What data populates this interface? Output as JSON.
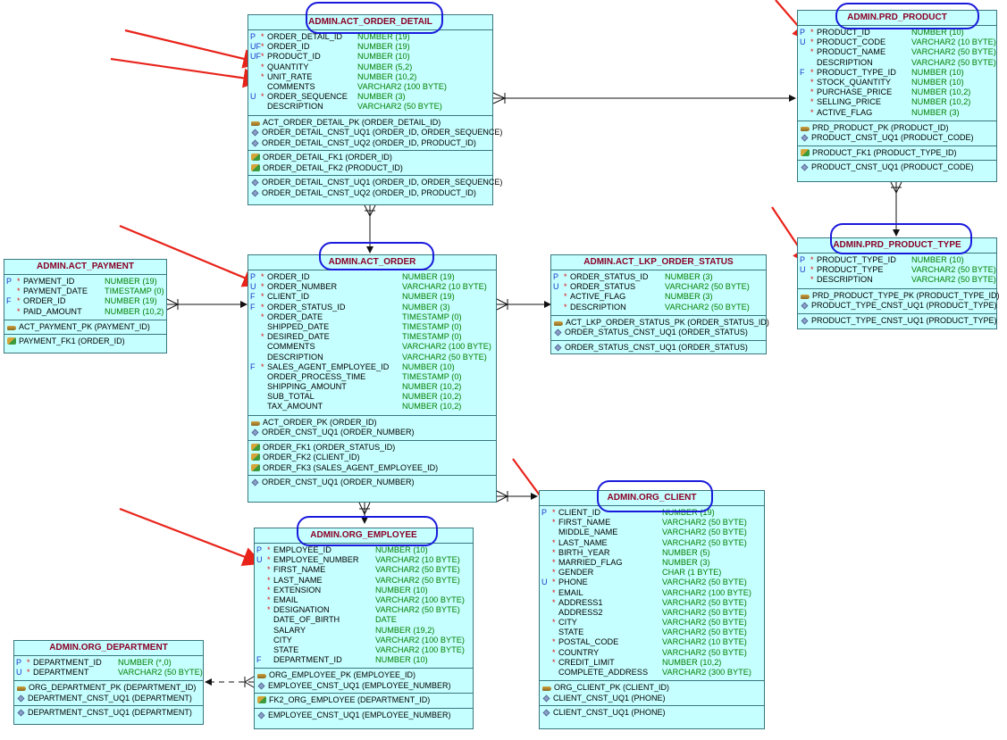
{
  "colors": {
    "table_fill": "#c6ffff",
    "border": "#37777f",
    "title": "#8a0026",
    "type": "#008000",
    "key": "#1a35c9",
    "mandatory": "#e01010",
    "highlight_oval": "#1a1adc",
    "arrow": "#e8231a"
  },
  "tables": {
    "act_order_detail": {
      "title": "ADMIN.ACT_ORDER_DETAIL",
      "columns": [
        {
          "key": "P",
          "mand": "*",
          "name": "ORDER_DETAIL_ID",
          "type": "NUMBER (19)"
        },
        {
          "key": "UF",
          "mand": "*",
          "name": "ORDER_ID",
          "type": "NUMBER (19)"
        },
        {
          "key": "UF",
          "mand": "*",
          "name": "PRODUCT_ID",
          "type": "NUMBER (10)"
        },
        {
          "key": "",
          "mand": "*",
          "name": "QUANTITY",
          "type": "NUMBER (5,2)"
        },
        {
          "key": "",
          "mand": "*",
          "name": "UNIT_RATE",
          "type": "NUMBER (10,2)"
        },
        {
          "key": "",
          "mand": "",
          "name": "COMMENTS",
          "type": "VARCHAR2 (100 BYTE)"
        },
        {
          "key": "U",
          "mand": "*",
          "name": "ORDER_SEQUENCE",
          "type": "NUMBER (3)"
        },
        {
          "key": "",
          "mand": "",
          "name": "DESCRIPTION",
          "type": "VARCHAR2 (50 BYTE)"
        }
      ],
      "sections": [
        [
          {
            "icon": "key",
            "text": "ACT_ORDER_DETAIL_PK (ORDER_DETAIL_ID)"
          },
          {
            "icon": "dia",
            "text": "ORDER_DETAIL_CNST_UQ1 (ORDER_ID, ORDER_SEQUENCE)"
          },
          {
            "icon": "dia",
            "text": "ORDER_DETAIL_CNST_UQ2 (ORDER_ID, PRODUCT_ID)"
          }
        ],
        [
          {
            "icon": "fk",
            "text": "ORDER_DETAIL_FK1 (ORDER_ID)"
          },
          {
            "icon": "fk",
            "text": "ORDER_DETAIL_FK2 (PRODUCT_ID)"
          }
        ],
        [
          {
            "icon": "dia",
            "text": "ORDER_DETAIL_CNST_UQ1 (ORDER_ID, ORDER_SEQUENCE)"
          },
          {
            "icon": "dia",
            "text": "ORDER_DETAIL_CNST_UQ2 (ORDER_ID, PRODUCT_ID)"
          }
        ]
      ]
    },
    "prd_product": {
      "title": "ADMIN.PRD_PRODUCT",
      "columns": [
        {
          "key": "P",
          "mand": "*",
          "name": "PRODUCT_ID",
          "type": "NUMBER (10)"
        },
        {
          "key": "U",
          "mand": "*",
          "name": "PRODUCT_CODE",
          "type": "VARCHAR2 (10 BYTE)"
        },
        {
          "key": "",
          "mand": "*",
          "name": "PRODUCT_NAME",
          "type": "VARCHAR2 (50 BYTE)"
        },
        {
          "key": "",
          "mand": "",
          "name": "DESCRIPTION",
          "type": "VARCHAR2 (50 BYTE)"
        },
        {
          "key": "F",
          "mand": "*",
          "name": "PRODUCT_TYPE_ID",
          "type": "NUMBER (10)"
        },
        {
          "key": "",
          "mand": "*",
          "name": "STOCK_QUANTITY",
          "type": "NUMBER (10)"
        },
        {
          "key": "",
          "mand": "*",
          "name": "PURCHASE_PRICE",
          "type": "NUMBER (10,2)"
        },
        {
          "key": "",
          "mand": "*",
          "name": "SELLING_PRICE",
          "type": "NUMBER (10,2)"
        },
        {
          "key": "",
          "mand": "*",
          "name": "ACTIVE_FLAG",
          "type": "NUMBER (3)"
        }
      ],
      "sections": [
        [
          {
            "icon": "key",
            "text": "PRD_PRODUCT_PK (PRODUCT_ID)"
          },
          {
            "icon": "dia",
            "text": "PRODUCT_CNST_UQ1 (PRODUCT_CODE)"
          }
        ],
        [
          {
            "icon": "fk",
            "text": "PRODUCT_FK1 (PRODUCT_TYPE_ID)"
          }
        ],
        [
          {
            "icon": "dia",
            "text": "PRODUCT_CNST_UQ1 (PRODUCT_CODE)"
          }
        ]
      ]
    },
    "prd_product_type": {
      "title": "ADMIN.PRD_PRODUCT_TYPE",
      "columns": [
        {
          "key": "P",
          "mand": "*",
          "name": "PRODUCT_TYPE_ID",
          "type": "NUMBER (10)"
        },
        {
          "key": "U",
          "mand": "*",
          "name": "PRODUCT_TYPE",
          "type": "VARCHAR2 (50 BYTE)"
        },
        {
          "key": "",
          "mand": "*",
          "name": "DESCRIPTION",
          "type": "VARCHAR2 (50 BYTE)"
        }
      ],
      "sections": [
        [
          {
            "icon": "key",
            "text": "PRD_PRODUCT_TYPE_PK (PRODUCT_TYPE_ID)"
          },
          {
            "icon": "dia",
            "text": "PRODUCT_TYPE_CNST_UQ1 (PRODUCT_TYPE)"
          }
        ],
        [
          {
            "icon": "dia",
            "text": "PRODUCT_TYPE_CNST_UQ1 (PRODUCT_TYPE)"
          }
        ]
      ]
    },
    "act_payment": {
      "title": "ADMIN.ACT_PAYMENT",
      "columns": [
        {
          "key": "P",
          "mand": "*",
          "name": "PAYMENT_ID",
          "type": "NUMBER (19)"
        },
        {
          "key": "",
          "mand": "*",
          "name": "PAYMENT_DATE",
          "type": "TIMESTAMP (0)"
        },
        {
          "key": "F",
          "mand": "*",
          "name": "ORDER_ID",
          "type": "NUMBER (19)"
        },
        {
          "key": "",
          "mand": "*",
          "name": "PAID_AMOUNT",
          "type": "NUMBER (10,2)"
        }
      ],
      "sections": [
        [
          {
            "icon": "key",
            "text": "ACT_PAYMENT_PK (PAYMENT_ID)"
          }
        ],
        [
          {
            "icon": "fk",
            "text": "PAYMENT_FK1 (ORDER_ID)"
          }
        ]
      ]
    },
    "act_order": {
      "title": "ADMIN.ACT_ORDER",
      "columns": [
        {
          "key": "P",
          "mand": "*",
          "name": "ORDER_ID",
          "type": "NUMBER (19)"
        },
        {
          "key": "U",
          "mand": "*",
          "name": "ORDER_NUMBER",
          "type": "VARCHAR2 (10 BYTE)"
        },
        {
          "key": "F",
          "mand": "*",
          "name": "CLIENT_ID",
          "type": "NUMBER (19)"
        },
        {
          "key": "F",
          "mand": "*",
          "name": "ORDER_STATUS_ID",
          "type": "NUMBER (3)"
        },
        {
          "key": "",
          "mand": "*",
          "name": "ORDER_DATE",
          "type": "TIMESTAMP (0)"
        },
        {
          "key": "",
          "mand": "",
          "name": "SHIPPED_DATE",
          "type": "TIMESTAMP (0)"
        },
        {
          "key": "",
          "mand": "*",
          "name": "DESIRED_DATE",
          "type": "TIMESTAMP (0)"
        },
        {
          "key": "",
          "mand": "",
          "name": "COMMENTS",
          "type": "VARCHAR2 (100 BYTE)"
        },
        {
          "key": "",
          "mand": "",
          "name": "DESCRIPTION",
          "type": "VARCHAR2 (50 BYTE)"
        },
        {
          "key": "F",
          "mand": "*",
          "name": "SALES_AGENT_EMPLOYEE_ID",
          "type": "NUMBER (10)"
        },
        {
          "key": "",
          "mand": "",
          "name": "ORDER_PROCESS_TIME",
          "type": "TIMESTAMP (0)"
        },
        {
          "key": "",
          "mand": "",
          "name": "SHIPPING_AMOUNT",
          "type": "NUMBER (10,2)"
        },
        {
          "key": "",
          "mand": "",
          "name": "SUB_TOTAL",
          "type": "NUMBER (10,2)"
        },
        {
          "key": "",
          "mand": "",
          "name": "TAX_AMOUNT",
          "type": "NUMBER (10,2)"
        }
      ],
      "sections": [
        [
          {
            "icon": "key",
            "text": "ACT_ORDER_PK (ORDER_ID)"
          },
          {
            "icon": "dia",
            "text": "ORDER_CNST_UQ1 (ORDER_NUMBER)"
          }
        ],
        [
          {
            "icon": "fk",
            "text": "ORDER_FK1 (ORDER_STATUS_ID)"
          },
          {
            "icon": "fk",
            "text": "ORDER_FK2 (CLIENT_ID)"
          },
          {
            "icon": "fk",
            "text": "ORDER_FK3 (SALES_AGENT_EMPLOYEE_ID)"
          }
        ],
        [
          {
            "icon": "dia",
            "text": "ORDER_CNST_UQ1 (ORDER_NUMBER)"
          }
        ]
      ]
    },
    "act_lkp_order_status": {
      "title": "ADMIN.ACT_LKP_ORDER_STATUS",
      "columns": [
        {
          "key": "P",
          "mand": "*",
          "name": "ORDER_STATUS_ID",
          "type": "NUMBER (3)"
        },
        {
          "key": "U",
          "mand": "*",
          "name": "ORDER_STATUS",
          "type": "VARCHAR2 (50 BYTE)"
        },
        {
          "key": "",
          "mand": "*",
          "name": "ACTIVE_FLAG",
          "type": "NUMBER (3)"
        },
        {
          "key": "",
          "mand": "*",
          "name": "DESCRIPTION",
          "type": "VARCHAR2 (50 BYTE)"
        }
      ],
      "sections": [
        [
          {
            "icon": "key",
            "text": "ACT_LKP_ORDER_STATUS_PK (ORDER_STATUS_ID)"
          },
          {
            "icon": "dia",
            "text": "ORDER_STATUS_CNST_UQ1 (ORDER_STATUS)"
          }
        ],
        [
          {
            "icon": "dia",
            "text": "ORDER_STATUS_CNST_UQ1 (ORDER_STATUS)"
          }
        ]
      ]
    },
    "org_employee": {
      "title": "ADMIN.ORG_EMPLOYEE",
      "columns": [
        {
          "key": "P",
          "mand": "*",
          "name": "EMPLOYEE_ID",
          "type": "NUMBER (10)"
        },
        {
          "key": "U",
          "mand": "*",
          "name": "EMPLOYEE_NUMBER",
          "type": "VARCHAR2 (10 BYTE)"
        },
        {
          "key": "",
          "mand": "*",
          "name": "FIRST_NAME",
          "type": "VARCHAR2 (50 BYTE)"
        },
        {
          "key": "",
          "mand": "*",
          "name": "LAST_NAME",
          "type": "VARCHAR2 (50 BYTE)"
        },
        {
          "key": "",
          "mand": "*",
          "name": "EXTENSION",
          "type": "NUMBER (10)"
        },
        {
          "key": "",
          "mand": "*",
          "name": "EMAIL",
          "type": "VARCHAR2 (100 BYTE)"
        },
        {
          "key": "",
          "mand": "*",
          "name": "DESIGNATION",
          "type": "VARCHAR2 (50 BYTE)"
        },
        {
          "key": "",
          "mand": "",
          "name": "DATE_OF_BIRTH",
          "type": "DATE"
        },
        {
          "key": "",
          "mand": "",
          "name": "SALARY",
          "type": "NUMBER (19,2)"
        },
        {
          "key": "",
          "mand": "",
          "name": "CITY",
          "type": "VARCHAR2 (100 BYTE)"
        },
        {
          "key": "",
          "mand": "",
          "name": "STATE",
          "type": "VARCHAR2 (100 BYTE)"
        },
        {
          "key": "F",
          "mand": "",
          "name": "DEPARTMENT_ID",
          "type": "NUMBER (10)"
        }
      ],
      "sections": [
        [
          {
            "icon": "key",
            "text": "ORG_EMPLOYEE_PK (EMPLOYEE_ID)"
          },
          {
            "icon": "dia",
            "text": "EMPLOYEE_CNST_UQ1 (EMPLOYEE_NUMBER)"
          }
        ],
        [
          {
            "icon": "fk",
            "text": "FK2_ORG_EMPLOYEE (DEPARTMENT_ID)"
          }
        ],
        [
          {
            "icon": "dia",
            "text": "EMPLOYEE_CNST_UQ1 (EMPLOYEE_NUMBER)"
          }
        ]
      ]
    },
    "org_client": {
      "title": "ADMIN.ORG_CLIENT",
      "columns": [
        {
          "key": "P",
          "mand": "*",
          "name": "CLIENT_ID",
          "type": "NUMBER (19)"
        },
        {
          "key": "",
          "mand": "*",
          "name": "FIRST_NAME",
          "type": "VARCHAR2 (50 BYTE)"
        },
        {
          "key": "",
          "mand": "",
          "name": "MIDDLE_NAME",
          "type": "VARCHAR2 (50 BYTE)"
        },
        {
          "key": "",
          "mand": "*",
          "name": "LAST_NAME",
          "type": "VARCHAR2 (50 BYTE)"
        },
        {
          "key": "",
          "mand": "*",
          "name": "BIRTH_YEAR",
          "type": "NUMBER (5)"
        },
        {
          "key": "",
          "mand": "*",
          "name": "MARRIED_FLAG",
          "type": "NUMBER (3)"
        },
        {
          "key": "",
          "mand": "*",
          "name": "GENDER",
          "type": "CHAR (1 BYTE)"
        },
        {
          "key": "U",
          "mand": "*",
          "name": "PHONE",
          "type": "VARCHAR2 (50 BYTE)"
        },
        {
          "key": "",
          "mand": "*",
          "name": "EMAIL",
          "type": "VARCHAR2 (100 BYTE)"
        },
        {
          "key": "",
          "mand": "*",
          "name": "ADDRESS1",
          "type": "VARCHAR2 (50 BYTE)"
        },
        {
          "key": "",
          "mand": "",
          "name": "ADDRESS2",
          "type": "VARCHAR2 (50 BYTE)"
        },
        {
          "key": "",
          "mand": "*",
          "name": "CITY",
          "type": "VARCHAR2 (50 BYTE)"
        },
        {
          "key": "",
          "mand": "",
          "name": "STATE",
          "type": "VARCHAR2 (50 BYTE)"
        },
        {
          "key": "",
          "mand": "*",
          "name": "POSTAL_CODE",
          "type": "VARCHAR2 (10 BYTE)"
        },
        {
          "key": "",
          "mand": "*",
          "name": "COUNTRY",
          "type": "VARCHAR2 (50 BYTE)"
        },
        {
          "key": "",
          "mand": "*",
          "name": "CREDIT_LIMIT",
          "type": "NUMBER (10,2)"
        },
        {
          "key": "",
          "mand": "",
          "name": "COMPLETE_ADDRESS",
          "type": "VARCHAR2 (300 BYTE)"
        }
      ],
      "sections": [
        [
          {
            "icon": "key",
            "text": "ORG_CLIENT_PK (CLIENT_ID)"
          },
          {
            "icon": "dia",
            "text": "CLIENT_CNST_UQ1 (PHONE)"
          }
        ],
        [
          {
            "icon": "dia",
            "text": "CLIENT_CNST_UQ1 (PHONE)"
          }
        ]
      ]
    },
    "org_department": {
      "title": "ADMIN.ORG_DEPARTMENT",
      "columns": [
        {
          "key": "P",
          "mand": "*",
          "name": "DEPARTMENT_ID",
          "type": "NUMBER (*,0)"
        },
        {
          "key": "U",
          "mand": "*",
          "name": "DEPARTMENT",
          "type": "VARCHAR2 (50 BYTE)"
        }
      ],
      "sections": [
        [
          {
            "icon": "key",
            "text": "ORG_DEPARTMENT_PK (DEPARTMENT_ID)"
          },
          {
            "icon": "dia",
            "text": "DEPARTMENT_CNST_UQ1 (DEPARTMENT)"
          }
        ],
        [
          {
            "icon": "dia",
            "text": "DEPARTMENT_CNST_UQ1 (DEPARTMENT)"
          }
        ]
      ]
    }
  }
}
